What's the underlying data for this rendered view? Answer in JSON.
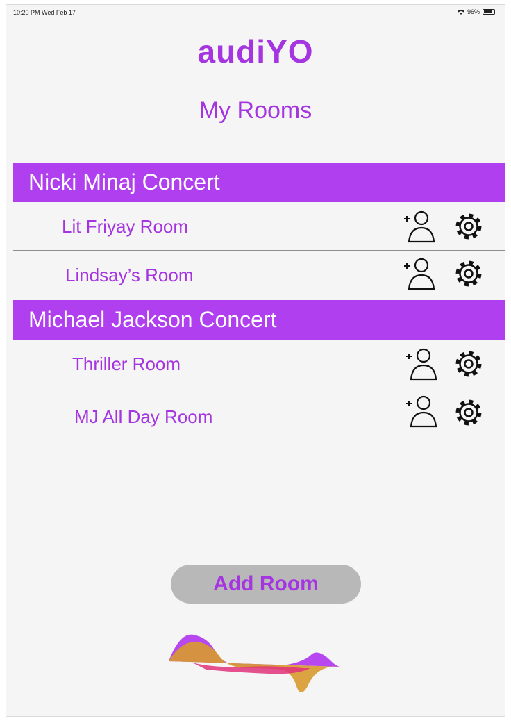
{
  "status_bar": {
    "time": "10:20 PM  Wed Feb 17",
    "battery": "96%"
  },
  "app": {
    "logo": "audiYO",
    "title": "My Rooms"
  },
  "groups": [
    {
      "name": "Nicki Minaj Concert",
      "rooms": [
        {
          "name": "Lit Friyay Room"
        },
        {
          "name": "Lindsay’s Room"
        }
      ]
    },
    {
      "name": "Michael Jackson Concert",
      "rooms": [
        {
          "name": "Thriller Room"
        },
        {
          "name": "MJ All Day Room"
        }
      ]
    }
  ],
  "actions": {
    "add_room": "Add Room"
  },
  "icons": {
    "add_member": "add-person-icon",
    "settings": "gear-icon",
    "brand": "sound-wave-logo"
  },
  "colors": {
    "accent": "#a535e0",
    "header_bar": "#b03ff0",
    "button": "#b8b8b8",
    "wave_orange": "#d89a2e",
    "wave_pink": "#e0327a"
  }
}
